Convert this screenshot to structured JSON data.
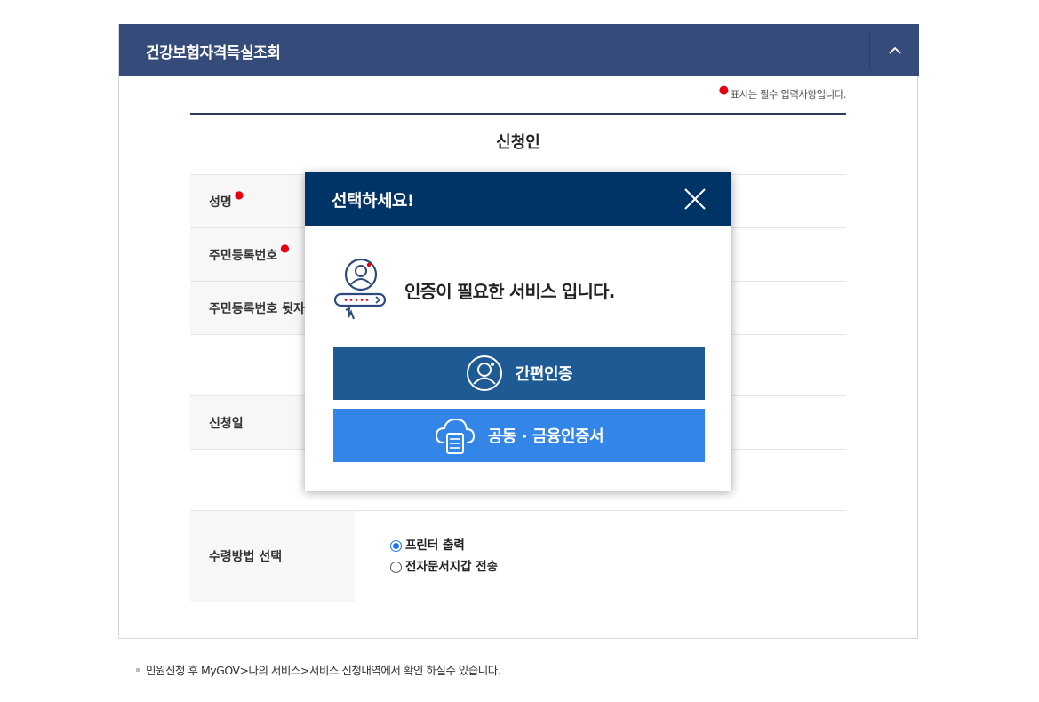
{
  "panel": {
    "title": "건강보험자격득실조회",
    "collapse_icon": "chevron-up-icon",
    "required_note": "표시는 필수 입력사항입니다.",
    "section_title": "신청인",
    "rows": [
      {
        "label": "성명",
        "required": true
      },
      {
        "label": "주민등록번호",
        "required": true
      },
      {
        "label": "주민등록번호 뒷자리",
        "required": false
      },
      {
        "label": "",
        "required": false
      },
      {
        "label": "신청일",
        "required": false
      },
      {
        "label": "",
        "required": false
      }
    ],
    "receive_method": {
      "label": "수령방법 선택",
      "options": [
        {
          "label": "프린터 출력",
          "selected": true
        },
        {
          "label": "전자문서지갑 전송",
          "selected": false
        }
      ]
    }
  },
  "footnote": "민원신청 후 MyGOV>나의 서비스>서비스 신청내역에서 확인 하실수 있습니다.",
  "modal": {
    "title": "선택하세요!",
    "close_icon": "close-icon",
    "auth_icon": "user-auth-icon",
    "message": "인증이 필요한 서비스 입니다.",
    "buttons": [
      {
        "label": "간편인증",
        "icon": "user-circle-icon",
        "color": "#1e5a94"
      },
      {
        "label": "공동 · 금융인증서",
        "icon": "cloud-server-icon",
        "color": "#3385e8"
      }
    ]
  },
  "colors": {
    "header_bg": "#354b7a",
    "modal_header_bg": "#003366",
    "required_dot": "#e60012"
  }
}
